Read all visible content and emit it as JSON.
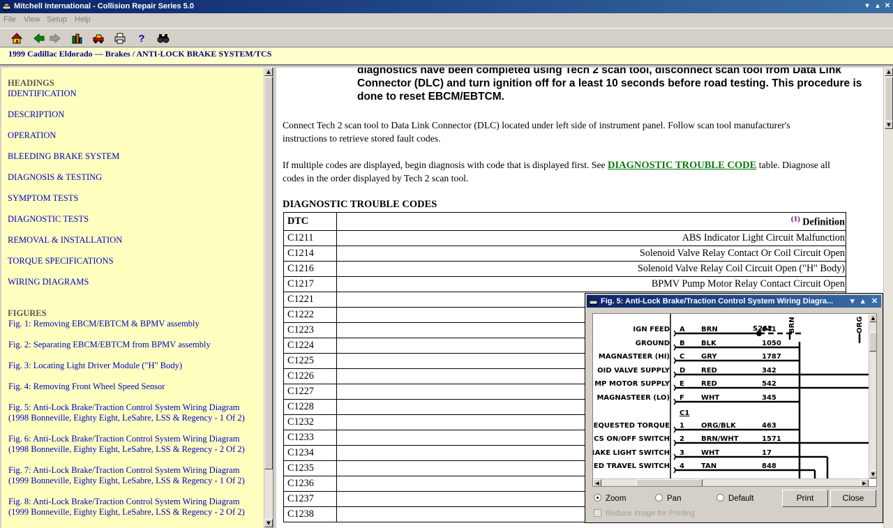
{
  "window": {
    "title": "Mitchell International - Collision Repair Series 5.0"
  },
  "menu": [
    "File",
    "View",
    "Setup",
    "Help"
  ],
  "toolbar": {
    "icons": [
      "home-icon",
      "back-arrow-icon",
      "forward-arrow-icon",
      "vehicle-select-icon",
      "car-icon",
      "print-icon",
      "help-icon",
      "find-binoculars-icon"
    ],
    "help_label": "?"
  },
  "breadcrumb": {
    "vehicle": "1999 Cadillac Eldorado",
    "path": "— Brakes / ANTI-LOCK BRAKE SYSTEM/TCS"
  },
  "sidebar": {
    "headings_title": "HEADINGS",
    "headings": [
      "IDENTIFICATION",
      "DESCRIPTION",
      "OPERATION",
      "BLEEDING BRAKE SYSTEM",
      "DIAGNOSIS & TESTING",
      "SYMPTOM TESTS",
      "DIAGNOSTIC TESTS",
      "REMOVAL & INSTALLATION",
      "TORQUE SPECIFICATIONS",
      "WIRING DIAGRAMS"
    ],
    "figures_title": "FIGURES",
    "figures": [
      [
        "Fig. 1: Removing EBCM/EBTCM & BPMV assembly"
      ],
      [
        "Fig. 2: Separating EBCM/EBTCM from BPMV assembly"
      ],
      [
        "Fig. 3: Locating Light Driver Module (\"H\" Body)"
      ],
      [
        "Fig. 4: Removing Front Wheel Speed Sensor"
      ],
      [
        "Fig. 5: Anti-Lock Brake/Traction Control System Wiring Diagram",
        "(1998 Bonneville, Eighty Eight, LeSabre, LSS & Regency - 1 Of 2)"
      ],
      [
        "Fig. 6: Anti-Lock Brake/Traction Control System Wiring Diagram",
        "(1998 Bonneville, Eighty Eight, LeSabre, LSS & Regency - 2 Of 2)"
      ],
      [
        "Fig. 7: Anti-Lock Brake/Traction Control System Wiring Diagram",
        "(1999 Bonneville, Eighty Eight, LeSabre, LSS & Regency - 1 Of 2)"
      ],
      [
        "Fig. 8: Anti-Lock Brake/Traction Control System Wiring Diagram",
        "(1999 Bonneville, Eighty Eight, LeSabre, LSS & Regency - 2 Of 2)"
      ]
    ]
  },
  "content": {
    "warning_lines": [
      "diagnostics have been completed using Tech 2 scan tool, disconnect scan tool from Data Link",
      "Connector (DLC) and turn ignition off for a least 10 seconds before road testing. This procedure is",
      "done to reset EBCM/EBTCM."
    ],
    "para1_lines": [
      "Connect Tech 2 scan tool to Data Link Connector (DLC) located under left side of instrument panel. Follow scan tool manufacturer's",
      "instructions to retrieve stored fault codes."
    ],
    "para2_pre": "If multiple codes are displayed, begin diagnosis with code that is displayed first. See ",
    "para2_link": "DIAGNOSTIC TROUBLE CODE",
    "para2_post": " table. Diagnose all",
    "para2_line2": "codes in the order displayed by Tech 2 scan tool.",
    "table_title": "DIAGNOSTIC TROUBLE CODES",
    "table_header": {
      "code": "DTC",
      "footnote": "(1)",
      "definition": "Definition"
    },
    "rows": [
      {
        "code": "C1211",
        "def": "ABS Indicator Light Circuit Malfunction"
      },
      {
        "code": "C1214",
        "def": "Solenoid Valve Relay Contact Or Coil Circuit Open"
      },
      {
        "code": "C1216",
        "def": "Solenoid Valve Relay Coil Circuit Open (\"H\" Body)"
      },
      {
        "code": "C1217",
        "def": "BPMV Pump Motor Relay Contact Circuit Open"
      },
      {
        "code": "C1221",
        "def": ""
      },
      {
        "code": "C1222",
        "def": ""
      },
      {
        "code": "C1223",
        "def": ""
      },
      {
        "code": "C1224",
        "def": ""
      },
      {
        "code": "C1225",
        "def": ""
      },
      {
        "code": "C1226",
        "def": ""
      },
      {
        "code": "C1227",
        "def": ""
      },
      {
        "code": "C1228",
        "def": ""
      },
      {
        "code": "C1232",
        "def": ""
      },
      {
        "code": "C1233",
        "def": ""
      },
      {
        "code": "C1234",
        "def": ""
      },
      {
        "code": "C1235",
        "def": ""
      },
      {
        "code": "C1236",
        "def": ""
      },
      {
        "code": "C1237",
        "def": ""
      },
      {
        "code": "C1238",
        "def": ""
      }
    ]
  },
  "figure_window": {
    "title": "Fig. 5: Anti-Lock Brake/Traction Control System Wiring Diagra...",
    "left_labels": [
      "IGN FEED",
      "GROUND",
      "MAGNASTEER (HI)",
      "OID VALVE SUPPLY",
      "MP MOTOR SUPPLY",
      "MAGNASTEER (LO)",
      "EQUESTED TORQUE",
      "CS ON/OFF SWITCH",
      "RAKE LIGHT SWITCH",
      "ED TRAVEL SWITCH"
    ],
    "pins": [
      "A",
      "B",
      "C",
      "D",
      "E",
      "F",
      "1",
      "2",
      "3",
      "4"
    ],
    "colors": [
      "BRN",
      "BLK",
      "GRY",
      "RED",
      "RED",
      "WHT",
      "ORG/BLK",
      "BRN/WHT",
      "WHT",
      "TAN"
    ],
    "circuits": [
      "641",
      "1050",
      "1787",
      "342",
      "542",
      "345",
      "463",
      "1571",
      "17",
      "848"
    ],
    "splice": "S262",
    "connector": "C1",
    "top_labels": [
      "BRN",
      "ORG"
    ],
    "radio": {
      "zoom": "Zoom",
      "pan": "Pan",
      "default": "Default",
      "selected": "zoom"
    },
    "print_label": "Print",
    "close_label": "Close",
    "reduce_label": "Reduce Image for Printing"
  }
}
